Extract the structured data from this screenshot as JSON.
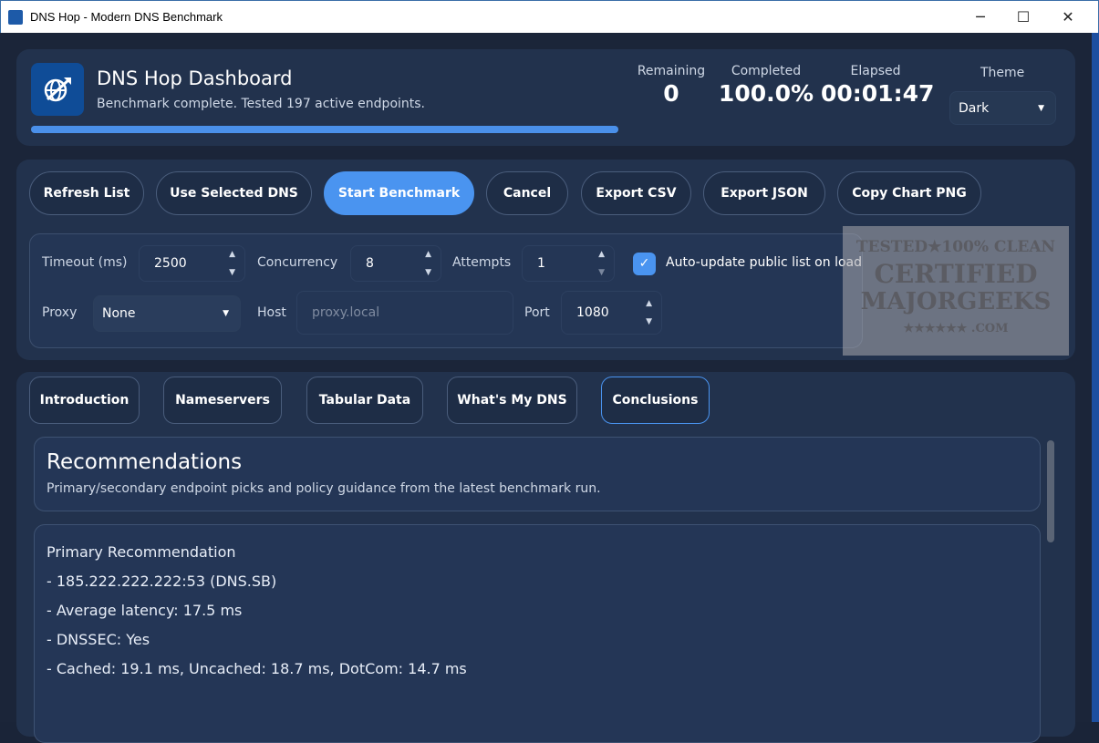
{
  "window": {
    "title": "DNS Hop - Modern DNS Benchmark",
    "minimize": "─",
    "maximize": "☐",
    "close": "✕"
  },
  "header": {
    "title": "DNS Hop Dashboard",
    "status": "Benchmark complete. Tested 197 active endpoints.",
    "progress_percent": 100,
    "stats": [
      {
        "label": "Remaining",
        "value": "0"
      },
      {
        "label": "Completed",
        "value": "100.0%"
      },
      {
        "label": "Elapsed",
        "value": "00:01:47"
      }
    ],
    "theme_label": "Theme",
    "theme_value": "Dark"
  },
  "toolbar": {
    "refresh": "Refresh List",
    "use_selected": "Use Selected DNS",
    "start": "Start Benchmark",
    "cancel": "Cancel",
    "export_csv": "Export CSV",
    "export_json": "Export JSON",
    "copy_chart": "Copy Chart PNG"
  },
  "settings": {
    "timeout_label": "Timeout (ms)",
    "timeout": "2500",
    "concurrency_label": "Concurrency",
    "concurrency": "8",
    "attempts_label": "Attempts",
    "attempts": "1",
    "auto_update_label": "Auto-update public list on load",
    "auto_update": true,
    "proxy_label": "Proxy",
    "proxy": "None",
    "host_label": "Host",
    "host_placeholder": "proxy.local",
    "port_label": "Port",
    "port": "1080"
  },
  "tabs": [
    "Introduction",
    "Nameservers",
    "Tabular Data",
    "What's My DNS",
    "Conclusions"
  ],
  "active_tab": "Conclusions",
  "recommendations": {
    "title": "Recommendations",
    "subtitle": "Primary/secondary endpoint picks and policy guidance from the latest benchmark run.",
    "lines": [
      "Primary Recommendation",
      "- 185.222.222.222:53 (DNS.SB)",
      "- Average latency: 17.5 ms",
      "- DNSSEC: Yes",
      "- Cached: 19.1 ms, Uncached: 18.7 ms, DotCom: 14.7 ms"
    ]
  },
  "watermark": {
    "line1": "TESTED ★ 100% CLEAN",
    "line2": "CERTIFIED",
    "line3": "MAJORGEEKS",
    "line4": "★★★★★★ .COM"
  },
  "colors": {
    "accent": "#4a94f0",
    "background": "#1b2539",
    "panel": "#22324d"
  }
}
